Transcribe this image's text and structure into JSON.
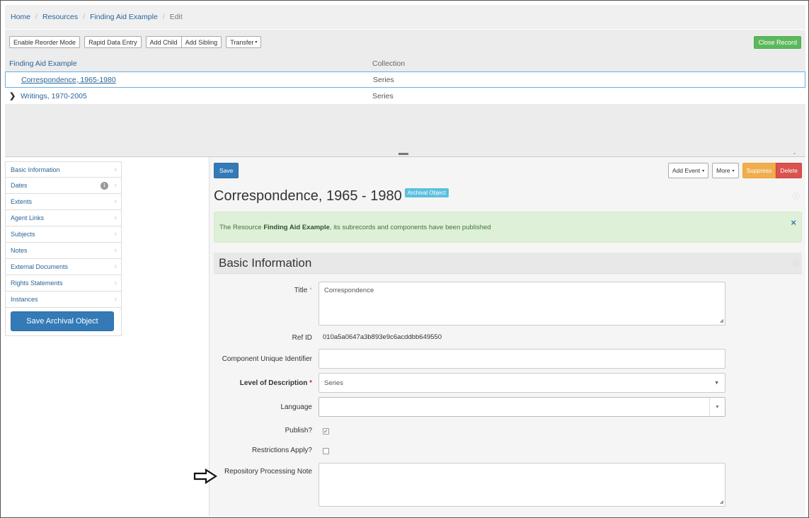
{
  "breadcrumb": [
    {
      "label": "Home",
      "active": false
    },
    {
      "label": "Resources",
      "active": false
    },
    {
      "label": "Finding Aid Example",
      "active": false
    },
    {
      "label": "Edit",
      "active": true
    }
  ],
  "toolbar": {
    "reorder": "Enable Reorder Mode",
    "rapid": "Rapid Data Entry",
    "add_child": "Add Child",
    "add_sibling": "Add Sibling",
    "transfer": "Transfer",
    "close_record": "Close Record"
  },
  "tree": {
    "header": {
      "title": "Finding Aid Example",
      "level": "Collection"
    },
    "rows": [
      {
        "title": "Correspondence, 1965-1980",
        "level": "Series",
        "selected": true
      },
      {
        "title": "Writings, 1970-2005",
        "level": "Series",
        "selected": false
      }
    ]
  },
  "sidebar": {
    "items": [
      {
        "label": "Basic Information"
      },
      {
        "label": "Dates",
        "badge": "1"
      },
      {
        "label": "Extents"
      },
      {
        "label": "Agent Links"
      },
      {
        "label": "Subjects"
      },
      {
        "label": "Notes"
      },
      {
        "label": "External Documents"
      },
      {
        "label": "Rights Statements"
      },
      {
        "label": "Instances"
      }
    ],
    "save_label": "Save Archival Object"
  },
  "actions": {
    "save": "Save",
    "add_event": "Add Event",
    "more": "More",
    "suppress": "Suppress",
    "delete": "Delete"
  },
  "record": {
    "title": "Correspondence, 1965 - 1980",
    "type_label": "Archival Object"
  },
  "alert": {
    "prefix": "The Resource ",
    "resource": "Finding Aid Example",
    "suffix": ", its subrecords and components have been published"
  },
  "section": {
    "title": "Basic Information"
  },
  "form": {
    "title_label": "Title",
    "title_value": "Correspondence",
    "ref_label": "Ref ID",
    "ref_value": "010a5a0647a3b893e9c6acddbb649550",
    "cuid_label": "Component Unique Identifier",
    "cuid_value": "",
    "level_label": "Level of Description",
    "level_value": "Series",
    "language_label": "Language",
    "language_value": "",
    "publish_label": "Publish?",
    "publish_checked": true,
    "restrictions_label": "Restrictions Apply?",
    "restrictions_checked": false,
    "rpn_label": "Repository Processing Note",
    "rpn_value": ""
  },
  "colors": {
    "primary": "#337ab7",
    "success": "#5cb85c",
    "warning": "#f0ad4e",
    "danger": "#d9534f",
    "info": "#5bc0de",
    "alert_bg": "#dff0d8"
  },
  "icons": {
    "expand": "chevron-right-icon",
    "sidebar_chevron": "chevron-right-icon",
    "help": "help-icon",
    "close": "close-icon",
    "annotation_arrow": "right-arrow-icon"
  }
}
